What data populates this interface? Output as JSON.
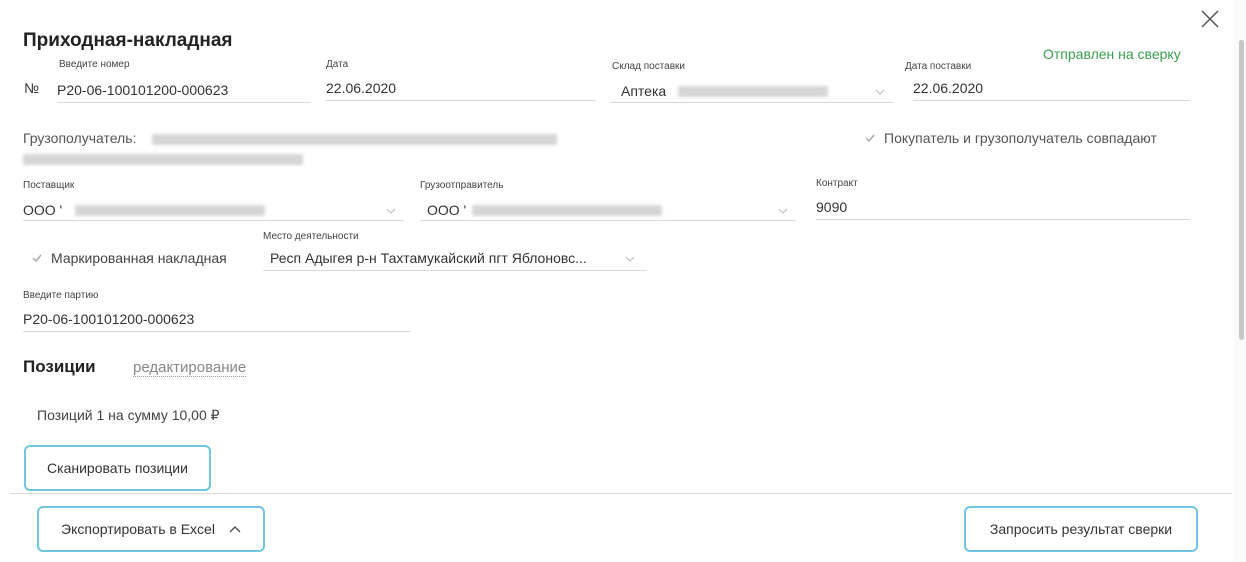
{
  "dialog": {
    "title": "Приходная-накладная",
    "status": "Отправлен на сверку",
    "status_color": "#3a9c4f"
  },
  "header_fields": {
    "number_prefix": "№",
    "number_label": "Введите номер",
    "number_value": "P20-06-100101200-000623",
    "date_label": "Дата",
    "date_value": "22.06.2020",
    "warehouse_label": "Склад поставки",
    "warehouse_value": "Аптека",
    "delivery_date_label": "Дата поставки",
    "delivery_date_value": "22.06.2020"
  },
  "consignee": {
    "label": "Грузополучатель:",
    "same_checkbox_label": "Покупатель и грузополучатель совпадают",
    "same_checked": true
  },
  "parties": {
    "supplier_label": "Поставщик",
    "supplier_value": "ООО '",
    "shipper_label": "Грузоотправитель",
    "shipper_value": "ООО '",
    "contract_label": "Контракт",
    "contract_value": "9090"
  },
  "marking": {
    "checkbox_label": "Маркированная накладная",
    "checked": true,
    "place_label": "Место деятельности",
    "place_value": "Респ Адыгея р-н Тахтамукайский пгт Яблоновс..."
  },
  "batch": {
    "label": "Введите партию",
    "value": "P20-06-100101200-000623"
  },
  "positions": {
    "title": "Позиции",
    "edit_link": "редактирование",
    "summary": "Позиций 1 на сумму 10,00 ₽",
    "scan_button": "Сканировать позиции"
  },
  "footer": {
    "export_button": "Экспортировать в Excel",
    "request_button": "Запросить результат сверки"
  },
  "icons": {
    "close": "close-icon",
    "chevron": "chevron-down-icon",
    "check": "checkmark-icon"
  },
  "colors": {
    "accent_border": "#6fc6de",
    "text": "#333333"
  }
}
